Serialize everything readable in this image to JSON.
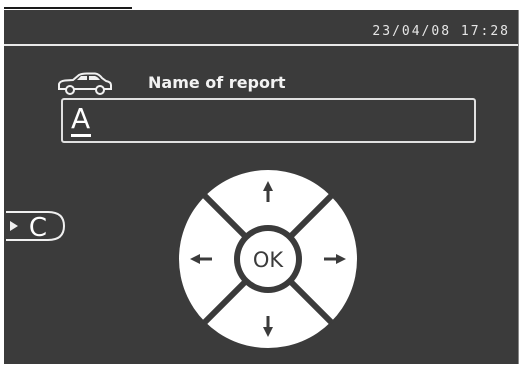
{
  "header": {
    "datetime": "23/04/08 17:28"
  },
  "report": {
    "icon": "car-icon",
    "label": "Name of report",
    "value": "A"
  },
  "controls": {
    "back_label": "C",
    "ok_label": "OK",
    "icons": [
      "arrow-up-icon",
      "arrow-down-icon",
      "arrow-left-icon",
      "arrow-right-icon"
    ]
  },
  "colors": {
    "screen_bg": "#3b3b3b",
    "foreground": "#ffffff"
  }
}
